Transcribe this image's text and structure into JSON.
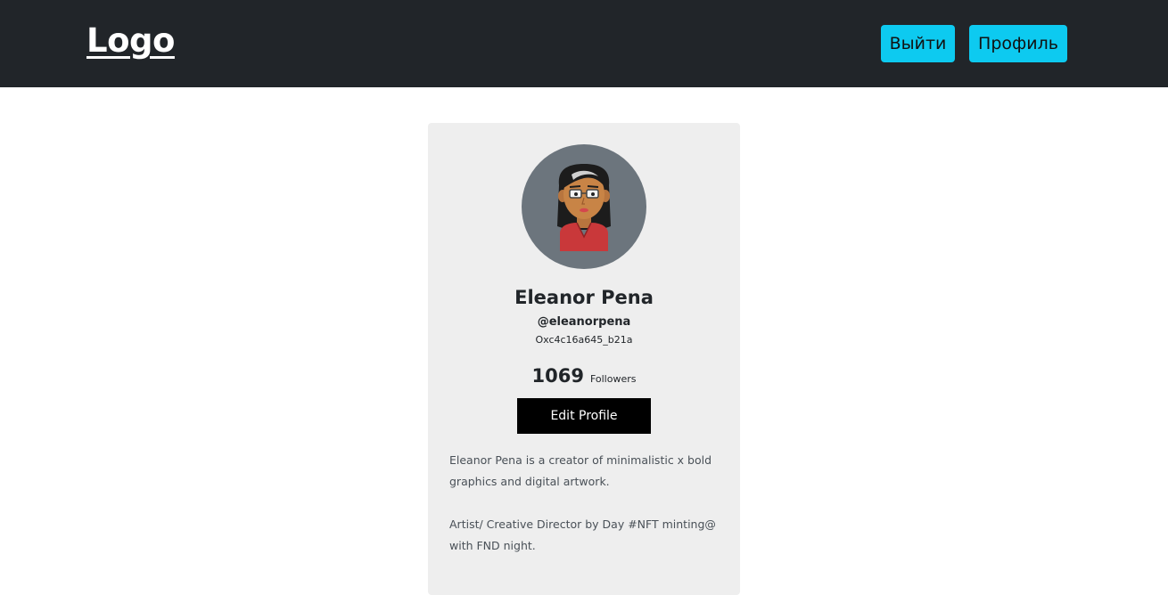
{
  "navbar": {
    "logo": "Logo",
    "logout_label": "Выйти",
    "profile_label": "Профиль"
  },
  "profile": {
    "name": "Eleanor Pena",
    "handle": "@eleanorpena",
    "wallet": "Oxc4c16a645_b21a",
    "followers_count": "1069",
    "followers_label": "Followers",
    "edit_label": "Edit Profile",
    "bio": [
      "Eleanor Pena is a creator of minimalistic x bold graphics and digital artwork.",
      "Artist/ Creative Director by Day #NFT minting@ with FND night."
    ]
  },
  "colors": {
    "navbar_bg": "#212529",
    "accent": "#0dcaf0",
    "card_bg": "#eeeeee",
    "avatar_bg": "#6c757d"
  }
}
